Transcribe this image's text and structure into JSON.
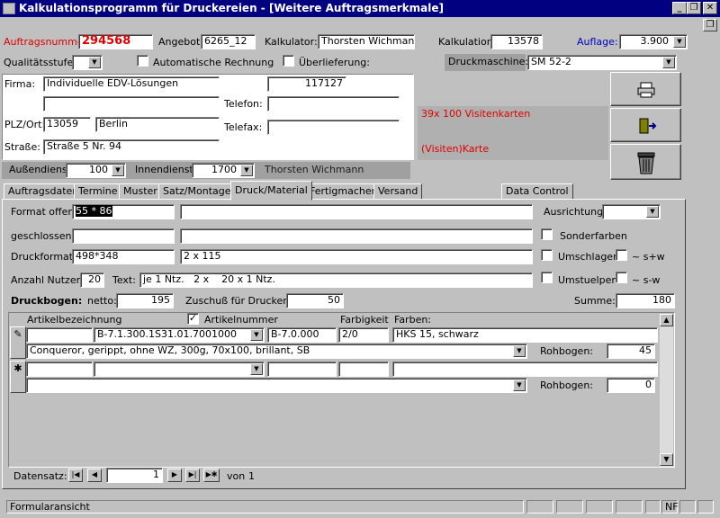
{
  "window": {
    "title": "Kalkulationsprogramm für Druckereien - [Weitere Auftragsmerkmale]"
  },
  "header": {
    "auftragsnummer_label": "Auftragsnummer",
    "auftragsnummer": "294568",
    "angebot_label": "Angebot",
    "angebot": "6265_12",
    "kalkulator_label": "Kalkulator:",
    "kalkulator": "Thorsten Wichmann",
    "kalkulation_label": "Kalkulation",
    "kalkulation": "13578",
    "auflage_label": "Auflage:",
    "auflage": "3.900",
    "qualitaet_label": "Qualitätsstufe:",
    "qualitaet": "",
    "auto_rechnung_label": "Automatische Rechnung",
    "ueberlieferung_label": "Überlieferung:",
    "druckmaschine_label": "Druckmaschine:",
    "druckmaschine": "SM 52-2"
  },
  "customer": {
    "firma_label": "Firma:",
    "firma": "Individuelle EDV-Lösungen",
    "kundennr": "117127",
    "firma2": "",
    "telefon_label": "Telefon:",
    "telefon": "",
    "plz_label": "PLZ/Ort:",
    "plz": "13059",
    "ort": "Berlin",
    "telefax_label": "Telefax:",
    "telefax": "",
    "strasse_label": "Straße:",
    "strasse": "Straße 5 Nr. 94"
  },
  "info": {
    "line1": "39x 100 Visitenkarten",
    "line2": "(Visiten)Karte"
  },
  "service": {
    "aussendienst_label": "Außendienst",
    "aussendienst": "100",
    "innendienst_label": "Innendienst",
    "innendienst": "1700",
    "innendienst_name": "Thorsten Wichmann"
  },
  "tabs": [
    "Auftragsdaten",
    "Termine",
    "Muster",
    "Satz/Montage",
    "Druck/Material",
    "Fertigmachen",
    "Versand",
    "Data Control"
  ],
  "druck": {
    "format_offen_label": "Format offen:",
    "format_offen": "55 * 86",
    "format_offen2": "",
    "ausrichtung_label": "Ausrichtung:",
    "ausrichtung": "",
    "geschlossen_label": "geschlossen:",
    "geschlossen": "",
    "geschlossen2": "",
    "sonderfarben_label": "Sonderfarben",
    "druckformat_label": "Druckformat:",
    "druckformat": "498*348",
    "druckformat2": "2 x 115",
    "umschlagen_label": "Umschlagen",
    "sw_plus_label": "~ s+w",
    "anzahl_nutzen_label": "Anzahl Nutzen:",
    "anzahl_nutzen": "20",
    "text_label": "Text:",
    "text": "je 1 Ntz.   2 x    20 x 1 Ntz.",
    "umstuelpen_label": "Umstuelpen",
    "sw_minus_label": "~ s-w",
    "druckbogen_label": "Druckbogen:",
    "netto_label": "netto:",
    "netto": "195",
    "zuschuss_label": "Zuschuß für Drucker:",
    "zuschuss": "50",
    "summe_label": "Summe:",
    "summe": "180"
  },
  "subform": {
    "col_artikelbezeichnung": "Artikelbezeichnung",
    "col_artikelnummer": "Artikelnummer",
    "col_farbigkeit": "Farbigkeit",
    "col_farben": "Farben:",
    "rows": [
      {
        "selector": "✎",
        "artikel": "B-7.1.300.1S31.01.7001000",
        "nummer": "B-7.0.000",
        "farbigkeit": "2/0",
        "farben": "HKS 15, schwarz",
        "beschreibung": "Conqueror, gerippt, ohne WZ, 300g, 70x100, brillant, SB",
        "rohbogen_label": "Rohbogen:",
        "rohbogen": "45"
      },
      {
        "selector": "✱",
        "artikel": "",
        "nummer": "",
        "farbigkeit": "",
        "farben": "",
        "beschreibung": "",
        "rohbogen_label": "Rohbogen:",
        "rohbogen": "0"
      }
    ]
  },
  "nav": {
    "label": "Datensatz:",
    "current": "1",
    "of_label": "von",
    "total": "1"
  },
  "status": {
    "text": "Formularansicht",
    "nf": "NF"
  }
}
